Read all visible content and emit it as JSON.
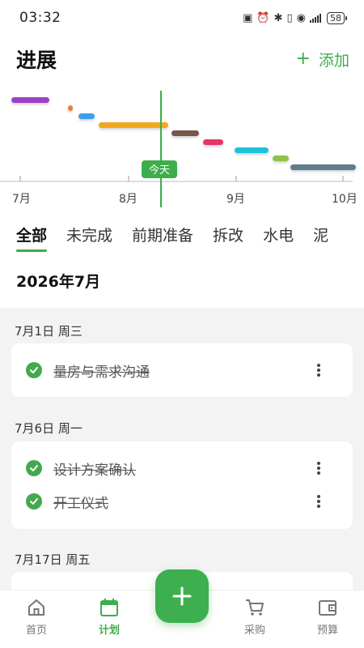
{
  "status": {
    "time": "03:32",
    "battery": "58"
  },
  "header": {
    "title": "进展",
    "add_label": "添加",
    "accent": "#3cae4a"
  },
  "gantt": {
    "months": [
      "7月",
      "8月",
      "9月",
      "10月"
    ],
    "today_label": "今天",
    "bar_colors": [
      "#9b3fc7",
      "#f07a3a",
      "#3aa0e8",
      "#f2a81d",
      "#7a5548",
      "#e8356b",
      "#1cc3d8",
      "#8bc34a",
      "#5f7d8c"
    ]
  },
  "tabs": [
    "全部",
    "未完成",
    "前期准备",
    "拆改",
    "水电",
    "泥"
  ],
  "active_tab": "全部",
  "month_heading": "2026年7月",
  "groups": [
    {
      "date": "7月1日 周三",
      "tasks": [
        "量房与需求沟通"
      ]
    },
    {
      "date": "7月6日 周一",
      "tasks": [
        "设计方案确认",
        "开工仪式"
      ]
    },
    {
      "date": "7月17日 周五",
      "tasks": []
    }
  ],
  "nav": {
    "items": [
      {
        "label": "首页",
        "icon": "home-icon"
      },
      {
        "label": "计划",
        "icon": "calendar-icon"
      },
      {
        "label": "采购",
        "icon": "cart-icon"
      },
      {
        "label": "预算",
        "icon": "wallet-icon"
      }
    ],
    "active": "计划"
  }
}
